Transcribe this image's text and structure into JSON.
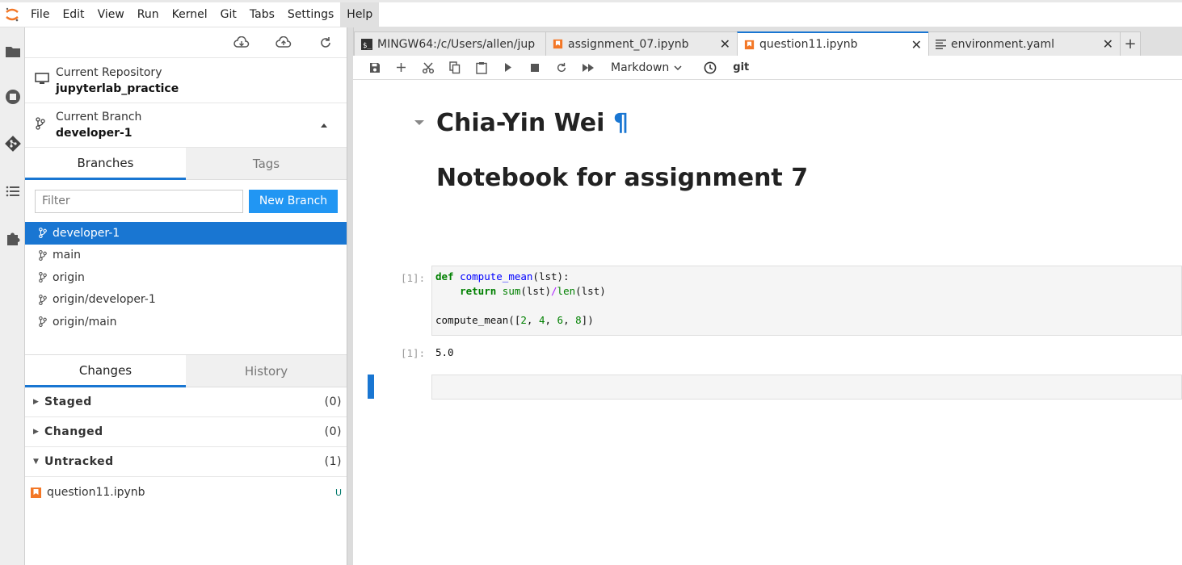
{
  "menubar": {
    "items": [
      "File",
      "Edit",
      "View",
      "Run",
      "Kernel",
      "Git",
      "Tabs",
      "Settings",
      "Help"
    ]
  },
  "activity_icons": [
    "folder-icon",
    "stop-circle-icon",
    "git-icon",
    "list-icon",
    "puzzle-icon"
  ],
  "git_panel": {
    "toolbar_icons": [
      "cloud-download-icon",
      "cloud-upload-icon",
      "refresh-icon"
    ],
    "repository_label": "Current Repository",
    "repository_value": "jupyterlab_practice",
    "branch_label": "Current Branch",
    "branch_value": "developer-1",
    "tabs": [
      "Branches",
      "Tags"
    ],
    "filter_placeholder": "Filter",
    "new_branch_label": "New Branch",
    "branches": [
      "developer-1",
      "main",
      "origin",
      "origin/developer-1",
      "origin/main"
    ],
    "selected_branch": "developer-1",
    "bottom_tabs": [
      "Changes",
      "History"
    ],
    "sections": [
      {
        "label": "Staged",
        "count": "(0)",
        "expanded": false
      },
      {
        "label": "Changed",
        "count": "(0)",
        "expanded": false
      },
      {
        "label": "Untracked",
        "count": "(1)",
        "expanded": true
      }
    ],
    "untracked_files": [
      {
        "name": "question11.ipynb",
        "status": "U"
      }
    ]
  },
  "tabs": [
    {
      "title": "MINGW64:/c/Users/allen/jup",
      "icon": "terminal-icon",
      "active": false
    },
    {
      "title": "assignment_07.ipynb",
      "icon": "notebook-icon",
      "active": false
    },
    {
      "title": "question11.ipynb",
      "icon": "notebook-icon",
      "active": true
    },
    {
      "title": "environment.yaml",
      "icon": "text-file-icon",
      "active": false
    }
  ],
  "add_tab": "+",
  "notebook_toolbar": {
    "cell_type": "Markdown",
    "git_label": "git"
  },
  "notebook": {
    "heading1": "Chia-Yin Wei",
    "pilcrow": "¶",
    "heading2": "Notebook for assignment 7",
    "input_prompt": "[1]:",
    "output_prompt": "[1]:",
    "code_lines": [
      "def compute_mean(lst):",
      "    return sum(lst)/len(lst)",
      "",
      "compute_mean([2, 4, 6, 8])"
    ],
    "output": "5.0"
  },
  "colors": {
    "accent": "#1976d2",
    "button": "#2196f3",
    "notebook_icon": "#f37726"
  }
}
